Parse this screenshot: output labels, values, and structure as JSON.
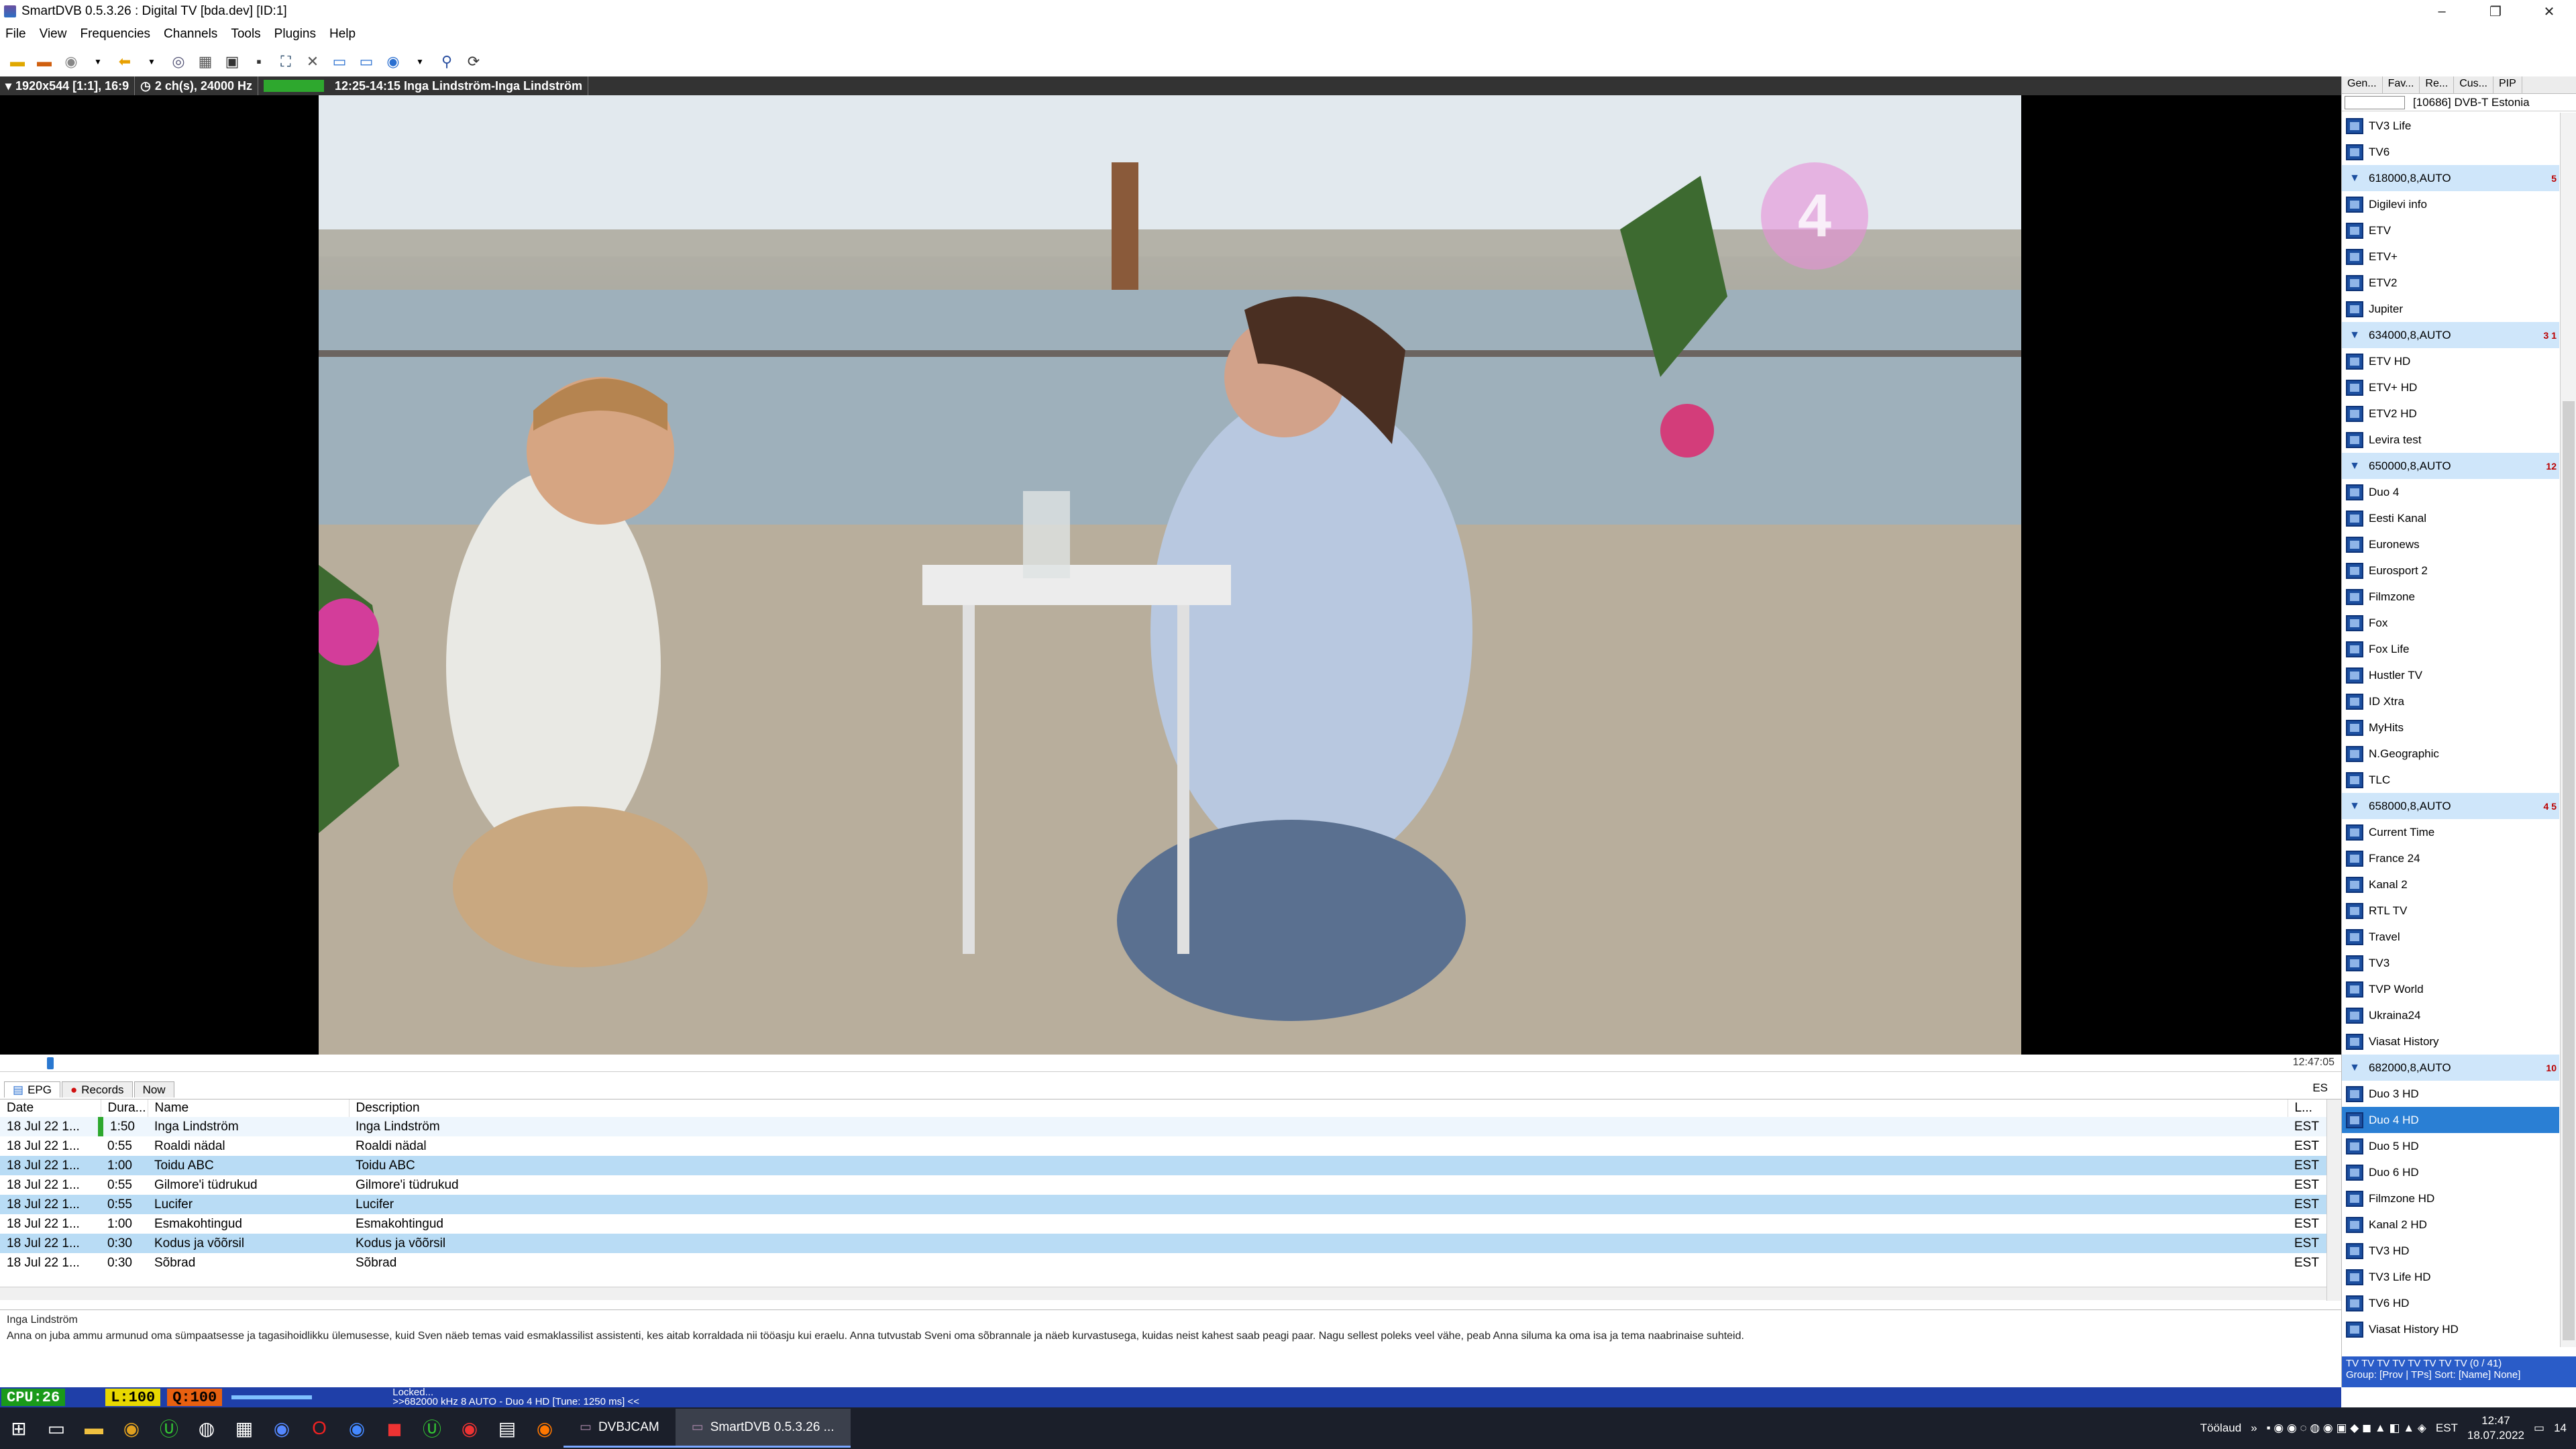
{
  "window": {
    "title": "SmartDVB 0.5.3.26 : Digital TV [bda.dev]  [ID:1]",
    "controls": [
      "–",
      "❐",
      "✕"
    ]
  },
  "menu": [
    "File",
    "View",
    "Frequencies",
    "Channels",
    "Tools",
    "Plugins",
    "Help"
  ],
  "toolbar": {
    "icons": [
      "open-folder-icon",
      "record-folder-icon",
      "record-icon",
      "back-icon",
      "snapshot-icon",
      "grid-icon",
      "fullscreen-icon",
      "tools-icon",
      "window-icon",
      "screen-icon",
      "dvd-icon",
      "zoom-icon",
      "refresh-icon"
    ]
  },
  "infobar": {
    "resolution": "1920x544 [1:1], 16:9",
    "audio": "2 ch(s), 24000 Hz",
    "program": "12:25-14:15 Inga Lindström-Inga Lindström"
  },
  "video": {
    "overlay_logo": "4"
  },
  "progress": {
    "time": "12:47:05",
    "position": 0.02
  },
  "tabs": {
    "items": [
      "EPG",
      "Records",
      "Now"
    ],
    "language": "ES"
  },
  "epg": {
    "columns": [
      "Date",
      "Dura...",
      "Name",
      "Description",
      "L..."
    ],
    "rows": [
      {
        "date": "18 Jul 22 1...",
        "dur": "1:50",
        "name": "Inga Lindström",
        "desc": "Inga Lindström",
        "lang": "EST"
      },
      {
        "date": "18 Jul 22 1...",
        "dur": "0:55",
        "name": "Roaldi nädal",
        "desc": "Roaldi nädal",
        "lang": "EST"
      },
      {
        "date": "18 Jul 22 1...",
        "dur": "1:00",
        "name": "Toidu ABC",
        "desc": "Toidu ABC",
        "lang": "EST"
      },
      {
        "date": "18 Jul 22 1...",
        "dur": "0:55",
        "name": "Gilmore'i tüdrukud",
        "desc": "Gilmore'i tüdrukud",
        "lang": "EST"
      },
      {
        "date": "18 Jul 22 1...",
        "dur": "0:55",
        "name": "Lucifer",
        "desc": "Lucifer",
        "lang": "EST"
      },
      {
        "date": "18 Jul 22 1...",
        "dur": "1:00",
        "name": "Esmakohtingud",
        "desc": "Esmakohtingud",
        "lang": "EST"
      },
      {
        "date": "18 Jul 22 1...",
        "dur": "0:30",
        "name": "Kodus ja võõrsil",
        "desc": "Kodus ja võõrsil",
        "lang": "EST"
      },
      {
        "date": "18 Jul 22 1...",
        "dur": "0:30",
        "name": "Sõbrad",
        "desc": "Sõbrad",
        "lang": "EST"
      }
    ]
  },
  "description": {
    "title": "Inga Lindström",
    "text": "Anna on juba ammu armunud oma sümpaatsesse ja tagasihoidlikku ülemusesse, kuid Sven näeb temas vaid esmaklassilist assistenti, kes aitab korraldada nii tööasju kui eraelu. Anna tutvustab Sveni oma sõbrannale ja näeb kurvastusega, kuidas neist kahest saab peagi paar. Nagu sellest poleks veel vähe, peab Anna siluma ka oma isa ja tema naabrinaise suhteid."
  },
  "statusbar": {
    "cpu": "CPU:26",
    "level": "L:100",
    "quality": "Q:100",
    "locked": "Locked...",
    "tune": ">>682000 kHz 8 AUTO - Duo 4 HD [Tune: 1250 ms] <<"
  },
  "sidebar": {
    "tabs": [
      "Gen...",
      "Fav...",
      "Re...",
      "Cus...",
      "PIP"
    ],
    "network": "[10686] DVB-T Estonia",
    "channels": [
      {
        "type": "ch",
        "name": "TV3 Life"
      },
      {
        "type": "ch",
        "name": "TV6"
      },
      {
        "type": "group",
        "name": "618000,8,AUTO",
        "badge": "5"
      },
      {
        "type": "ch",
        "name": "Digilevi info"
      },
      {
        "type": "ch",
        "name": "ETV"
      },
      {
        "type": "ch",
        "name": "ETV+"
      },
      {
        "type": "ch",
        "name": "ETV2"
      },
      {
        "type": "ch",
        "name": "Jupiter"
      },
      {
        "type": "group",
        "name": "634000,8,AUTO",
        "badge": "3 1"
      },
      {
        "type": "ch",
        "name": "ETV HD"
      },
      {
        "type": "ch",
        "name": "ETV+ HD"
      },
      {
        "type": "ch",
        "name": "ETV2 HD"
      },
      {
        "type": "ch",
        "name": "Levira test"
      },
      {
        "type": "group",
        "name": "650000,8,AUTO",
        "badge": "12"
      },
      {
        "type": "ch",
        "name": "Duo 4"
      },
      {
        "type": "ch",
        "name": "Eesti Kanal"
      },
      {
        "type": "ch",
        "name": "Euronews"
      },
      {
        "type": "ch",
        "name": "Eurosport 2"
      },
      {
        "type": "ch",
        "name": "Filmzone"
      },
      {
        "type": "ch",
        "name": "Fox"
      },
      {
        "type": "ch",
        "name": "Fox Life"
      },
      {
        "type": "ch",
        "name": "Hustler TV"
      },
      {
        "type": "ch",
        "name": "ID Xtra"
      },
      {
        "type": "ch",
        "name": "MyHits"
      },
      {
        "type": "ch",
        "name": "N.Geographic"
      },
      {
        "type": "ch",
        "name": "TLC"
      },
      {
        "type": "group",
        "name": "658000,8,AUTO",
        "badge": "4 5"
      },
      {
        "type": "ch",
        "name": "Current Time"
      },
      {
        "type": "ch",
        "name": "France 24"
      },
      {
        "type": "ch",
        "name": "Kanal 2"
      },
      {
        "type": "ch",
        "name": "RTL TV"
      },
      {
        "type": "ch",
        "name": "Travel"
      },
      {
        "type": "ch",
        "name": "TV3"
      },
      {
        "type": "ch",
        "name": "TVP World"
      },
      {
        "type": "ch",
        "name": "Ukraina24"
      },
      {
        "type": "ch",
        "name": "Viasat History"
      },
      {
        "type": "group",
        "name": "682000,8,AUTO",
        "badge": "10"
      },
      {
        "type": "ch",
        "name": "Duo 3 HD"
      },
      {
        "type": "ch",
        "name": "Duo 4 HD",
        "selected": true
      },
      {
        "type": "ch",
        "name": "Duo 5 HD"
      },
      {
        "type": "ch",
        "name": "Duo 6 HD"
      },
      {
        "type": "ch",
        "name": "Filmzone HD"
      },
      {
        "type": "ch",
        "name": "Kanal 2 HD"
      },
      {
        "type": "ch",
        "name": "TV3 HD"
      },
      {
        "type": "ch",
        "name": "TV3 Life HD"
      },
      {
        "type": "ch",
        "name": "TV6 HD"
      },
      {
        "type": "ch",
        "name": "Viasat History HD"
      }
    ],
    "footer_line1": "TV  TV  TV  TV  TV  TV  TV  TV  (0 / 41)",
    "footer_line2": "Group: [Prov | TPs]  Sort: [Name] None]"
  },
  "taskbar": {
    "apps": [
      "DVBJCAM",
      "SmartDVB 0.5.3.26 ..."
    ],
    "tray_label": "Töölaud",
    "lang": "EST",
    "time": "12:47",
    "date": "18.07.2022",
    "notif": "14"
  }
}
